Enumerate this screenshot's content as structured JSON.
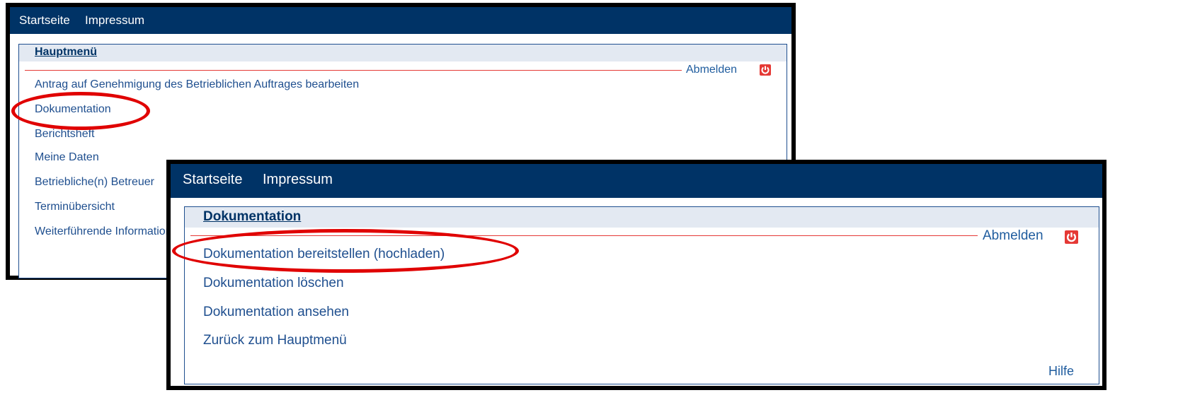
{
  "window1": {
    "nav": [
      "Startseite",
      "Impressum"
    ],
    "panel_title": "Hauptmenü",
    "logout_label": "Abmelden",
    "menu_items": [
      "Antrag auf Genehmigung des Betrieblichen Auftrages bearbeiten",
      "Dokumentation",
      "Berichtsheft",
      "Meine Daten",
      "Betriebliche(n) Betreuer",
      "Terminübersicht",
      "Weiterführende Informationen"
    ]
  },
  "window2": {
    "nav": [
      "Startseite",
      "Impressum"
    ],
    "panel_title": "Dokumentation",
    "logout_label": "Abmelden",
    "menu_items": [
      "Dokumentation bereitstellen (hochladen)",
      "Dokumentation löschen",
      "Dokumentation ansehen",
      "Zurück zum Hauptmenü"
    ],
    "help_label": "Hilfe"
  },
  "colors": {
    "nav_bg": "#003366",
    "link": "#1f4f8f",
    "panel_head_bg": "#e3e9f2",
    "highlight_ring": "#e00000",
    "power_icon": "#e53935"
  },
  "icons": [
    "power-icon"
  ]
}
